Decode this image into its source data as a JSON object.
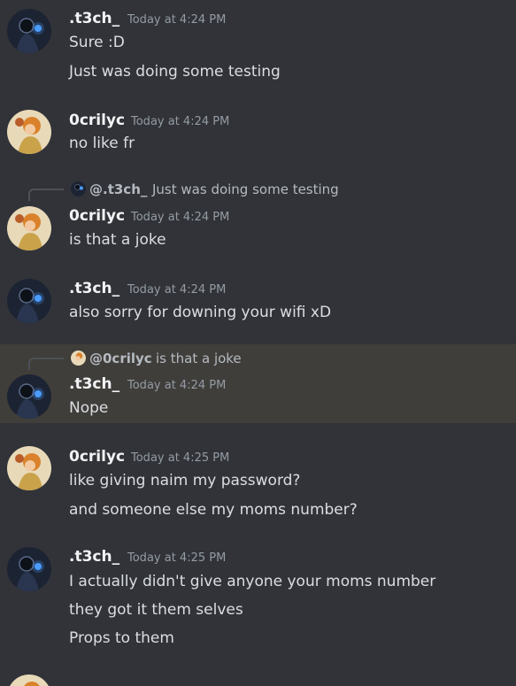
{
  "colors": {
    "background": "#313338",
    "highlight": "#403e3a",
    "author": "#f2f3f5",
    "text": "#dbdee1",
    "muted": "#949ba4"
  },
  "messages": [
    {
      "author": ".t3ch_",
      "timestamp": "Today at 4:24 PM",
      "avatar": "t3ch-avatar",
      "lines": [
        "Sure :D",
        "Just was doing some testing"
      ]
    },
    {
      "author": "0crilyc",
      "timestamp": "Today at 4:24 PM",
      "avatar": "ocrilyc-avatar",
      "lines": [
        "no like fr"
      ]
    },
    {
      "reply": {
        "author": "@.t3ch_",
        "text": "Just was doing some testing"
      },
      "author": "0crilyc",
      "timestamp": "Today at 4:24 PM",
      "avatar": "ocrilyc-avatar",
      "lines": [
        "is that a joke"
      ]
    },
    {
      "author": ".t3ch_",
      "timestamp": "Today at 4:24 PM",
      "avatar": "t3ch-avatar",
      "lines": [
        "also sorry for downing your wifi xD"
      ]
    },
    {
      "reply": {
        "author": "@0crilyc",
        "text": "is that a joke"
      },
      "author": ".t3ch_",
      "timestamp": "Today at 4:24 PM",
      "avatar": "t3ch-avatar",
      "highlighted": true,
      "lines": [
        "Nope"
      ]
    },
    {
      "author": "0crilyc",
      "timestamp": "Today at 4:25 PM",
      "avatar": "ocrilyc-avatar",
      "lines": [
        "like giving naim my password?",
        "and someone else my moms number?"
      ]
    },
    {
      "author": ".t3ch_",
      "timestamp": "Today at 4:25 PM",
      "avatar": "t3ch-avatar",
      "lines": [
        "I actually didn't give anyone your moms number",
        "they got it them selves",
        "Props to them"
      ]
    },
    {
      "author": "",
      "timestamp": "",
      "avatar": "ocrilyc-avatar",
      "lines": []
    }
  ]
}
